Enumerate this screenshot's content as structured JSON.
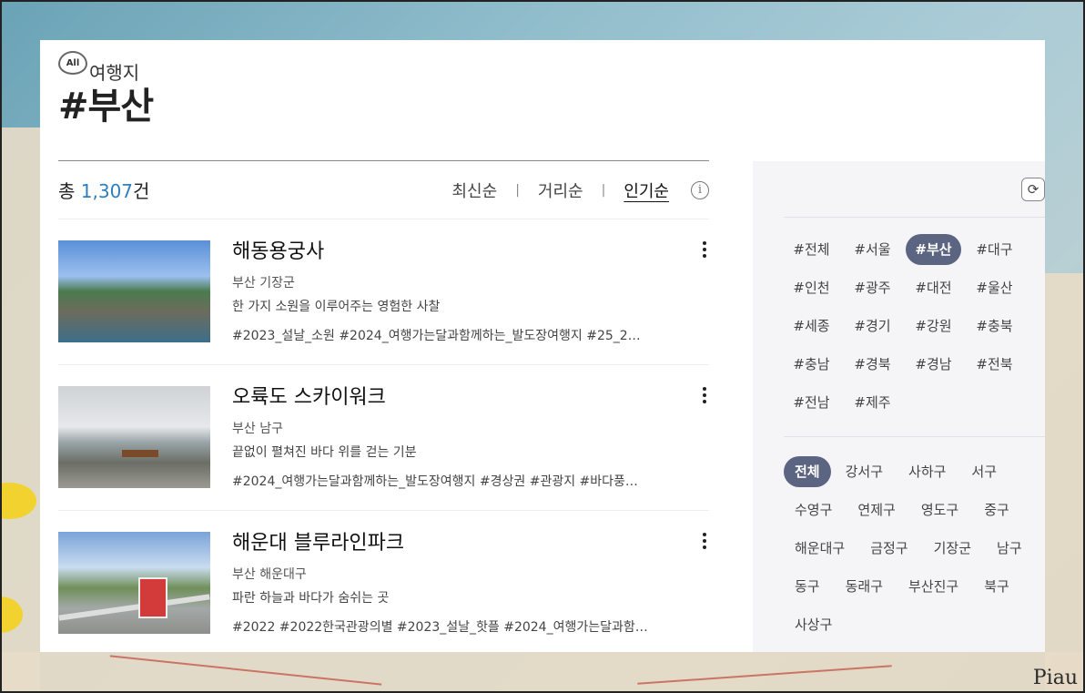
{
  "background": {
    "corner_text": "Piau"
  },
  "header": {
    "badge": "All",
    "category": "여행지",
    "title": "#부산"
  },
  "summary": {
    "prefix": "총",
    "count": "1,307",
    "suffix": "건"
  },
  "sort": {
    "options": [
      "최신순",
      "거리순",
      "인기순"
    ],
    "separator": "|",
    "active": "인기순",
    "info_glyph": "i"
  },
  "items": [
    {
      "title": "해동용궁사",
      "location": "부산 기장군",
      "description": "한 가지 소원을 이루어주는 영험한 사찰",
      "tags": "#2023_설날_소원 #2024_여행가는달과함께하는_발도장여행지 #25_2…"
    },
    {
      "title": "오륙도 스카이워크",
      "location": "부산 남구",
      "description": "끝없이 펼쳐진 바다 위를 걷는 기분",
      "tags": "#2024_여행가는달과함께하는_발도장여행지 #경상권 #관광지 #바다풍…"
    },
    {
      "title": "해운대 블루라인파크",
      "location": "부산 해운대구",
      "description": "파란 하늘과 바다가 숨쉬는 곳",
      "tags": "#2022 #2022한국관광의별 #2023_설날_핫플 #2024_여행가는달과함…"
    }
  ],
  "filter": {
    "refresh_glyph": "⟳",
    "regions": [
      "#전체",
      "#서울",
      "#부산",
      "#대구",
      "#인천",
      "#광주",
      "#대전",
      "#울산",
      "#세종",
      "#경기",
      "#강원",
      "#충북",
      "#충남",
      "#경북",
      "#경남",
      "#전북",
      "#전남",
      "#제주"
    ],
    "selected_region": "#부산",
    "districts": [
      "전체",
      "강서구",
      "사하구",
      "서구",
      "수영구",
      "연제구",
      "영도구",
      "중구",
      "해운대구",
      "금정구",
      "기장군",
      "남구",
      "동구",
      "동래구",
      "부산진구",
      "북구",
      "사상구"
    ],
    "selected_district": "전체"
  }
}
